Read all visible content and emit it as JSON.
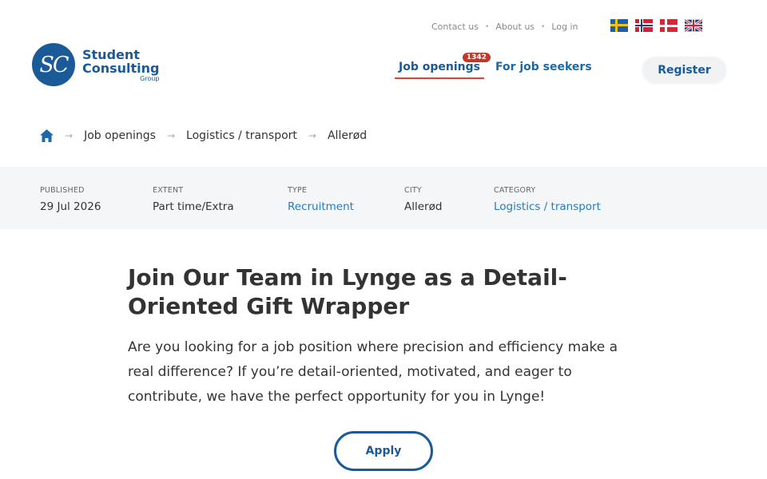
{
  "top_links": {
    "contact": "Contact us",
    "about": "About us",
    "login": "Log in"
  },
  "flags": [
    "swedish-flag-icon",
    "norwegian-flag-icon",
    "danish-flag-icon",
    "uk-flag-icon"
  ],
  "logo": {
    "initials": "SC",
    "line1": "Student",
    "line2": "Consulting",
    "group": "Group"
  },
  "nav": {
    "job_openings": "Job openings",
    "job_count": "1342",
    "job_seekers": "For job seekers"
  },
  "register_label": "Register",
  "breadcrumb": {
    "items": [
      "Job openings",
      "Logistics / transport",
      "Allerød"
    ]
  },
  "meta": {
    "published": {
      "label": "PUBLISHED",
      "value": "29 Jul 2026"
    },
    "extent": {
      "label": "EXTENT",
      "value": "Part time/Extra"
    },
    "type": {
      "label": "TYPE",
      "value": "Recruitment"
    },
    "city": {
      "label": "CITY",
      "value": "Allerød"
    },
    "category": {
      "label": "CATEGORY",
      "value": "Logistics / transport"
    }
  },
  "main": {
    "title": "Join Our Team in Lynge as a Detail-Oriented Gift Wrapper",
    "intro": "Are you looking for a job position where precision and efficiency make a real difference? If you’re detail-oriented, motivated, and eager to contribute, we have the perfect opportunity for you in Lynge!",
    "apply_label": "Apply"
  },
  "colors": {
    "brand": "#1a5a99",
    "accent": "#d64541",
    "link": "#2a7ab8",
    "meta_bg": "#f5f6f7"
  }
}
